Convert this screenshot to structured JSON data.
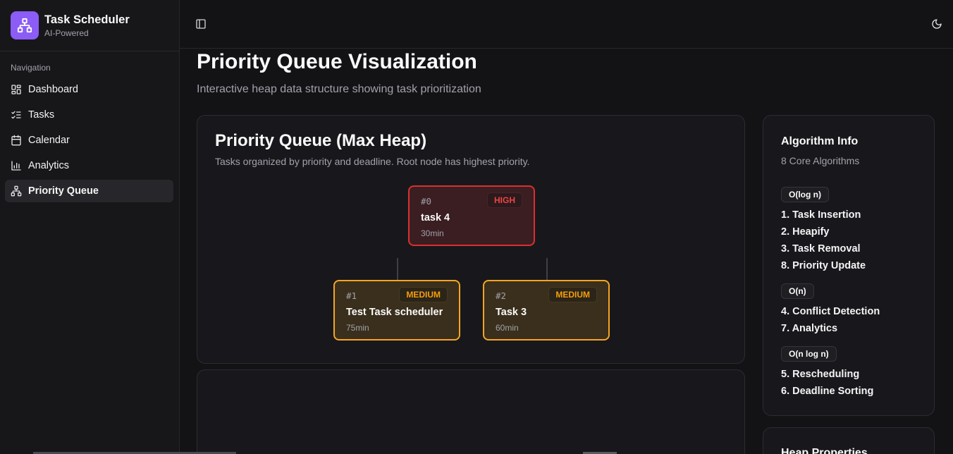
{
  "brand": {
    "title": "Task Scheduler",
    "subtitle": "AI-Powered"
  },
  "sidebar": {
    "heading": "Navigation",
    "items": [
      {
        "label": "Dashboard",
        "icon": "dashboard-icon"
      },
      {
        "label": "Tasks",
        "icon": "list-checks-icon"
      },
      {
        "label": "Calendar",
        "icon": "calendar-icon"
      },
      {
        "label": "Analytics",
        "icon": "bar-chart-icon"
      },
      {
        "label": "Priority Queue",
        "icon": "network-icon",
        "active": true
      }
    ]
  },
  "header": {
    "toggle_icon": "sidebar-toggle-icon",
    "theme_icon": "moon-icon"
  },
  "page": {
    "title": "Priority Queue Visualization",
    "subtitle": "Interactive heap data structure showing task prioritization"
  },
  "heap": {
    "title": "Priority Queue (Max Heap)",
    "subtitle": "Tasks organized by priority and deadline. Root node has highest priority.",
    "nodes": [
      {
        "index": "#0",
        "priority": "HIGH",
        "name": "task 4",
        "duration": "30min"
      },
      {
        "index": "#1",
        "priority": "MEDIUM",
        "name": "Test Task scheduler",
        "duration": "75min"
      },
      {
        "index": "#2",
        "priority": "MEDIUM",
        "name": "Task 3",
        "duration": "60min"
      }
    ]
  },
  "algorithm": {
    "title": "Algorithm Info",
    "subtitle": "8 Core Algorithms",
    "groups": [
      {
        "complexity": "O(log n)",
        "items": [
          "1. Task Insertion",
          "2. Heapify",
          "3. Task Removal",
          "8. Priority Update"
        ]
      },
      {
        "complexity": "O(n)",
        "items": [
          "4. Conflict Detection",
          "7. Analytics"
        ]
      },
      {
        "complexity": "O(n log n)",
        "items": [
          "5. Rescheduling",
          "6. Deadline Sorting"
        ]
      }
    ]
  },
  "heap_properties": {
    "title": "Heap Properties"
  },
  "colors": {
    "accent": "#8b5cf6",
    "high": "#dc2f2f",
    "medium": "#f5a524"
  }
}
